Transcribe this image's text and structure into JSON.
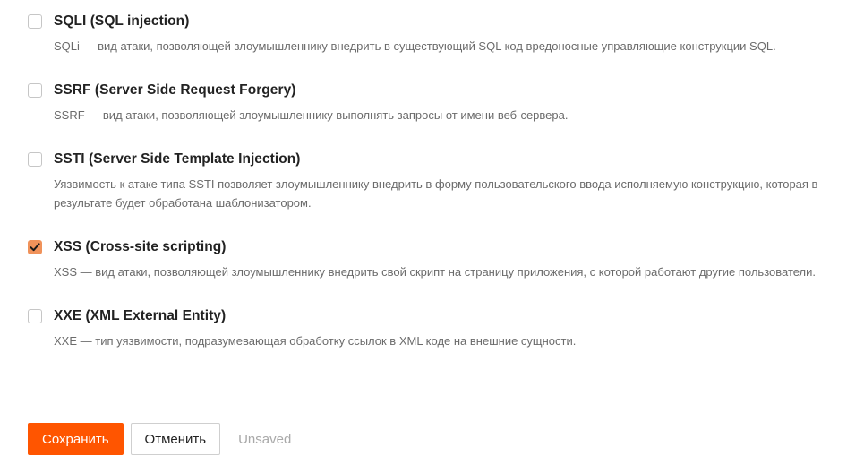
{
  "options": [
    {
      "title": "SQLI (SQL injection)",
      "description": "SQLi — вид атаки, позволяющей злоумышленнику внедрить в существующий SQL код вредоносные управляющие конструкции SQL.",
      "checked": false
    },
    {
      "title": "SSRF (Server Side Request Forgery)",
      "description": "SSRF — вид атаки, позволяющей злоумышленнику выполнять запросы от имени веб-сервера.",
      "checked": false
    },
    {
      "title": "SSTI (Server Side Template Injection)",
      "description": "Уязвимость к атаке типа SSTI позволяет злоумышленнику внедрить в форму пользовательского ввода исполняемую конструкцию, которая в результате будет обработана шаблонизатором.",
      "checked": false
    },
    {
      "title": "XSS (Cross-site scripting)",
      "description": "XSS — вид атаки, позволяющей злоумышленнику внедрить свой скрипт на страницу приложения, с которой работают другие пользователи.",
      "checked": true
    },
    {
      "title": "XXE (XML External Entity)",
      "description": "XXE — тип уязвимости, подразумевающая обработку ссылок в XML коде на внешние сущности.",
      "checked": false
    }
  ],
  "actions": {
    "save_label": "Сохранить",
    "cancel_label": "Отменить",
    "status": "Unsaved"
  },
  "colors": {
    "accent": "#ff5500",
    "checkbox_checked": "#f0925a"
  }
}
